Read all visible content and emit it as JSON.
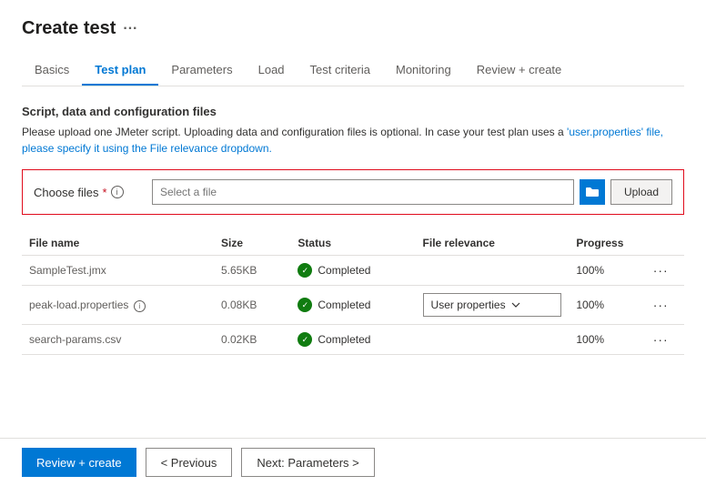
{
  "page": {
    "title": "Create test",
    "ellipsis": "···"
  },
  "tabs": [
    {
      "id": "basics",
      "label": "Basics",
      "active": false
    },
    {
      "id": "test-plan",
      "label": "Test plan",
      "active": true
    },
    {
      "id": "parameters",
      "label": "Parameters",
      "active": false
    },
    {
      "id": "load",
      "label": "Load",
      "active": false
    },
    {
      "id": "test-criteria",
      "label": "Test criteria",
      "active": false
    },
    {
      "id": "monitoring",
      "label": "Monitoring",
      "active": false
    },
    {
      "id": "review-create",
      "label": "Review + create",
      "active": false
    }
  ],
  "section": {
    "title": "Script, data and configuration files",
    "desc_part1": "Please upload one JMeter script. Uploading data and configuration files is optional. In case your test plan uses a",
    "desc_link": "'user.properties' file, please specify it using the File relevance dropdown.",
    "choose_files_label": "Choose files",
    "required_marker": "*",
    "file_input_placeholder": "Select a file",
    "upload_button": "Upload"
  },
  "table": {
    "headers": [
      "File name",
      "Size",
      "Status",
      "File relevance",
      "Progress"
    ],
    "rows": [
      {
        "filename": "SampleTest.jmx",
        "size": "5.65KB",
        "status": "Completed",
        "relevance": "",
        "progress": "100%",
        "has_dropdown": false,
        "has_info": false
      },
      {
        "filename": "peak-load.properties",
        "size": "0.08KB",
        "status": "Completed",
        "relevance": "User properties",
        "progress": "100%",
        "has_dropdown": true,
        "has_info": true
      },
      {
        "filename": "search-params.csv",
        "size": "0.02KB",
        "status": "Completed",
        "relevance": "",
        "progress": "100%",
        "has_dropdown": false,
        "has_info": false
      }
    ]
  },
  "footer": {
    "review_create": "Review + create",
    "previous": "< Previous",
    "next": "Next: Parameters >"
  }
}
